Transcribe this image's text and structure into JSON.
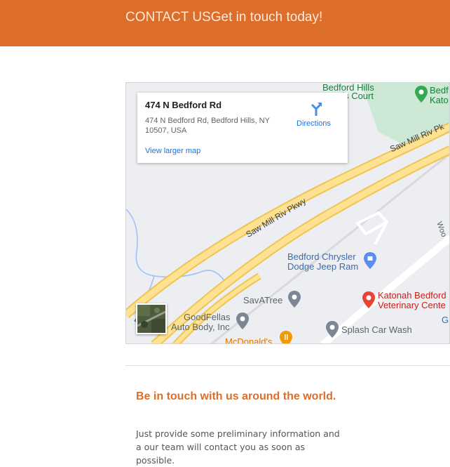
{
  "header": {
    "title": "CONTACT USGet in touch today!",
    "background": "#dc6e2a"
  },
  "map": {
    "info_card": {
      "title": "474 N Bedford Rd",
      "address": "474 N Bedford Rd, Bedford Hills, NY 10507, USA",
      "directions_label": "Directions",
      "larger_map_link": "View larger map"
    },
    "places": {
      "bedford_hills_courts_line1": "Bedford Hills",
      "bedford_hills_courts_line2": "Tennis Court",
      "bedford_katonah_line1": "Bedf",
      "bedford_katonah_line2": "Kato",
      "chrysler_line1": "Bedford Chrysler",
      "chrysler_line2": "Dodge Jeep Ram",
      "savatree": "SavATree",
      "katonah_vet_line1": "Katonah Bedford",
      "katonah_vet_line2": "Veterinary Cente",
      "goodfellas_line1": "GoodFellas",
      "goodfellas_line2": "Auto Body, Inc",
      "splash": "Splash Car Wash",
      "mcdonalds": "McDonald's",
      "edge_letter": "G",
      "woo": "Woo"
    },
    "roads": {
      "saw_mill_1": "Saw Mill Riv Pkwy",
      "saw_mill_2": "Saw Mill Riv Pk",
      "pkwy_left": "Pkwy"
    },
    "icons": {
      "directions": "directions-icon",
      "pin_green": "park-pin-icon",
      "pin_blue": "shopping-pin-icon",
      "pin_red": "veterinary-pin-icon",
      "pin_gray": "place-pin-icon",
      "pin_orange": "restaurant-pin-icon"
    }
  },
  "contact": {
    "heading": "Be in touch with us around the world.",
    "text": "Just provide some preliminary information and a our team will contact you as soon as possible."
  }
}
